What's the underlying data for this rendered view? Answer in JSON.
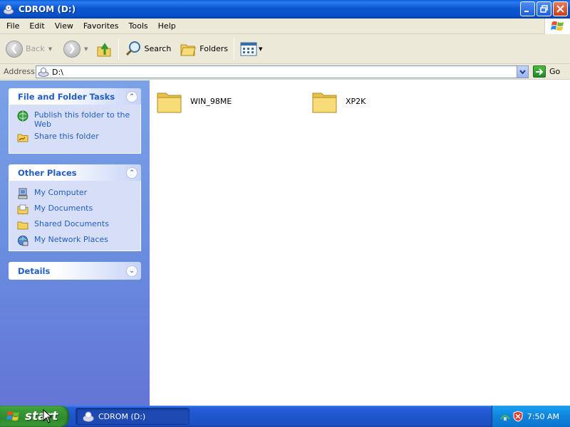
{
  "window": {
    "title": "CDROM (D:)"
  },
  "menu": [
    "File",
    "Edit",
    "View",
    "Favorites",
    "Tools",
    "Help"
  ],
  "toolbar": {
    "back_label": "Back",
    "search_label": "Search",
    "folders_label": "Folders"
  },
  "address": {
    "label": "Address",
    "value": "D:\\",
    "go_label": "Go"
  },
  "left_pane": {
    "file_tasks": {
      "title": "File and Folder Tasks",
      "items": [
        {
          "label": "Publish this folder to the Web",
          "icon": "globe-publish-icon"
        },
        {
          "label": "Share this folder",
          "icon": "share-folder-icon"
        }
      ]
    },
    "other_places": {
      "title": "Other Places",
      "items": [
        {
          "label": "My Computer",
          "icon": "my-computer-icon"
        },
        {
          "label": "My Documents",
          "icon": "my-documents-icon"
        },
        {
          "label": "Shared Documents",
          "icon": "shared-documents-icon"
        },
        {
          "label": "My Network Places",
          "icon": "network-places-icon"
        }
      ]
    },
    "details": {
      "title": "Details"
    }
  },
  "content": {
    "items": [
      {
        "name": "WIN_98ME",
        "type": "folder"
      },
      {
        "name": "XP2K",
        "type": "folder"
      }
    ]
  },
  "taskbar": {
    "start_label": "start",
    "window_button_label": "CDROM (D:)",
    "clock": "7:50 AM"
  },
  "colors": {
    "titlebar_blue": "#0b57d0",
    "taskpane_link": "#215dc6",
    "start_green": "#3d9d3a",
    "folder_yellow": "#f5d66b"
  }
}
